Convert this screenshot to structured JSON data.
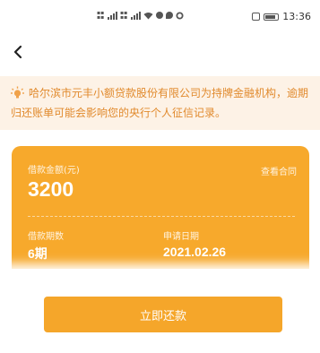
{
  "status_bar": {
    "time": "13:36",
    "icons": [
      "sim-icon",
      "signal-icon",
      "sim-icon",
      "signal-icon",
      "wifi-icon",
      "message-icon",
      "chat-icon",
      "sync-icon",
      "vibrate-icon",
      "battery-icon"
    ]
  },
  "nav": {
    "back_icon": "chevron-left-icon"
  },
  "notice": {
    "icon": "lightbulb-icon",
    "text": "哈尔滨市元丰小额贷款股份有限公司为持牌金融机构，逾期归还账单可能会影响您的央行个人征信记录。"
  },
  "loan_card": {
    "amount_label": "借款金额(元)",
    "amount_value": "3200",
    "view_contract": "查看合同",
    "term_label": "借款期数",
    "term_value": "6期",
    "apply_date_label": "申请日期",
    "apply_date_value": "2021.02.26",
    "color": "#f7a92c"
  },
  "actions": {
    "repay_label": "立即还款"
  },
  "colors": {
    "accent": "#f5a62a",
    "notice_bg": "#fdf2e6",
    "notice_text": "#e18a2d"
  }
}
